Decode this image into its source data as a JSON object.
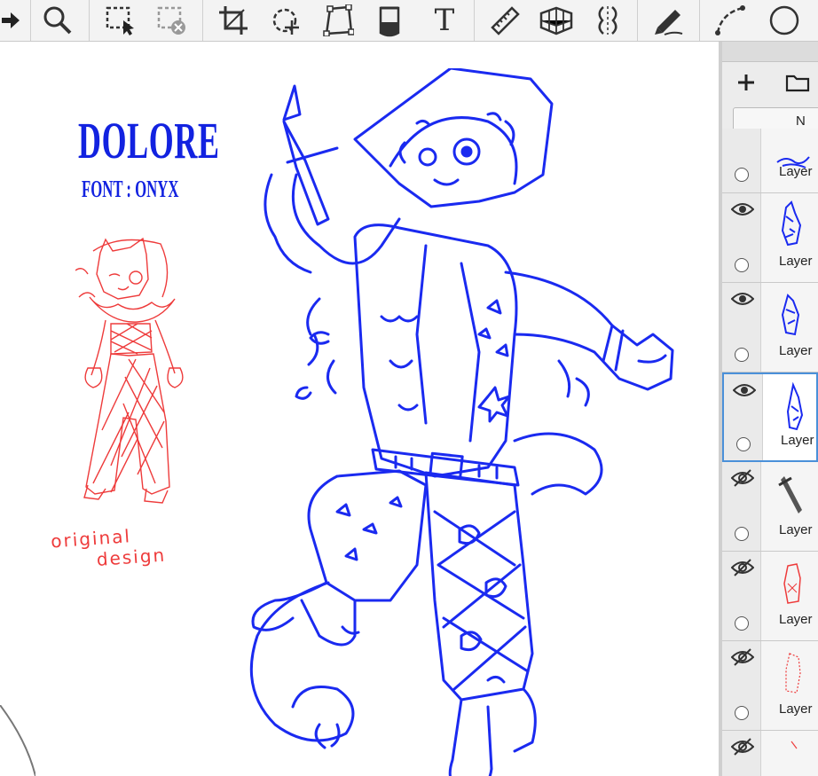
{
  "toolbar": {
    "tools": [
      {
        "icon": "arrow-right-icon"
      },
      {
        "icon": "zoom-icon"
      },
      {
        "icon": "selection-icon"
      },
      {
        "icon": "deselect-icon"
      },
      {
        "icon": "crop-icon"
      },
      {
        "icon": "transform-icon"
      },
      {
        "icon": "distort-icon"
      },
      {
        "icon": "fill-bucket-icon"
      },
      {
        "icon": "text-tool-icon",
        "label": "T"
      },
      {
        "icon": "ruler-icon"
      },
      {
        "icon": "perspective-grid-icon"
      },
      {
        "icon": "symmetry-icon"
      },
      {
        "icon": "pen-icon"
      },
      {
        "icon": "curve-icon"
      },
      {
        "icon": "ellipse-icon"
      }
    ]
  },
  "canvas": {
    "title_text": "DOLORE",
    "font_text": "FONT : ONYX",
    "note_line1": "original",
    "note_line2": "design",
    "colors": {
      "title": "#1222e0",
      "sketch_red": "#ee3b3b",
      "lineart": "#1a2af0"
    }
  },
  "layer_panel": {
    "blend_label": "N",
    "layers": [
      {
        "name": "Layer",
        "visible": null,
        "thumb": "blue-scribble"
      },
      {
        "name": "Layer",
        "visible": true,
        "thumb": "blue-figure"
      },
      {
        "name": "Layer",
        "visible": true,
        "thumb": "blue-figure"
      },
      {
        "name": "Layer",
        "visible": true,
        "thumb": "blue-figure",
        "selected": true
      },
      {
        "name": "Layer",
        "visible": false,
        "thumb": "dagger"
      },
      {
        "name": "Layer",
        "visible": false,
        "thumb": "red-sketch"
      },
      {
        "name": "Layer",
        "visible": false,
        "thumb": "red-sketch"
      },
      {
        "name": "",
        "visible": false,
        "thumb": "red-sketch"
      }
    ]
  }
}
